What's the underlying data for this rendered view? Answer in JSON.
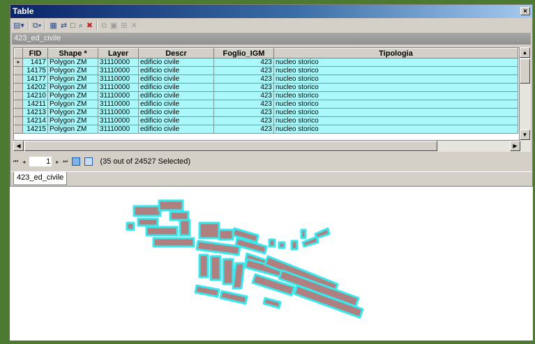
{
  "window": {
    "title": "Table",
    "close_glyph": "×"
  },
  "toolbar": {
    "icons": [
      "table-options-icon",
      "related-tables-icon",
      "select-by-attributes-icon",
      "switch-selection-icon",
      "clear-selection-icon",
      "zoom-to-selected-icon",
      "delete-selected-icon",
      "copy-icon",
      "paste-icon",
      "add-icon",
      "delete-icon"
    ]
  },
  "layer": {
    "name": "423_ed_civile"
  },
  "table": {
    "columns": [
      "FID",
      "Shape *",
      "Layer",
      "Descr",
      "Foglio_IGM",
      "Tipologia"
    ],
    "rows": [
      {
        "fid": "1417",
        "shape": "Polygon ZM",
        "layer": "31110000",
        "descr": "edificio civile",
        "foglio": "423",
        "tipologia": "nucleo storico"
      },
      {
        "fid": "14175",
        "shape": "Polygon ZM",
        "layer": "31110000",
        "descr": "edificio civile",
        "foglio": "423",
        "tipologia": "nucleo storico"
      },
      {
        "fid": "14177",
        "shape": "Polygon ZM",
        "layer": "31110000",
        "descr": "edificio civile",
        "foglio": "423",
        "tipologia": "nucleo storico"
      },
      {
        "fid": "14202",
        "shape": "Polygon ZM",
        "layer": "31110000",
        "descr": "edificio civile",
        "foglio": "423",
        "tipologia": "nucleo storico"
      },
      {
        "fid": "14210",
        "shape": "Polygon ZM",
        "layer": "31110000",
        "descr": "edificio civile",
        "foglio": "423",
        "tipologia": "nucleo storico"
      },
      {
        "fid": "14211",
        "shape": "Polygon ZM",
        "layer": "31110000",
        "descr": "edificio civile",
        "foglio": "423",
        "tipologia": "nucleo storico"
      },
      {
        "fid": "14213",
        "shape": "Polygon ZM",
        "layer": "31110000",
        "descr": "edificio civile",
        "foglio": "423",
        "tipologia": "nucleo storico"
      },
      {
        "fid": "14214",
        "shape": "Polygon ZM",
        "layer": "31110000",
        "descr": "edificio civile",
        "foglio": "423",
        "tipologia": "nucleo storico"
      },
      {
        "fid": "14215",
        "shape": "Polygon ZM",
        "layer": "31110000",
        "descr": "edificio civile",
        "foglio": "423",
        "tipologia": "nucleo storico"
      }
    ],
    "current_row_marker": "▸"
  },
  "navigation": {
    "first": "⏮",
    "prev": "◂",
    "record": "1",
    "next": "▸",
    "last": "⏭",
    "selection_text": "(35 out of 24527 Selected)"
  },
  "tab": {
    "label": "423_ed_civile"
  },
  "map": {
    "fill_color": "#b08080",
    "outline_color": "#38e8ec"
  }
}
